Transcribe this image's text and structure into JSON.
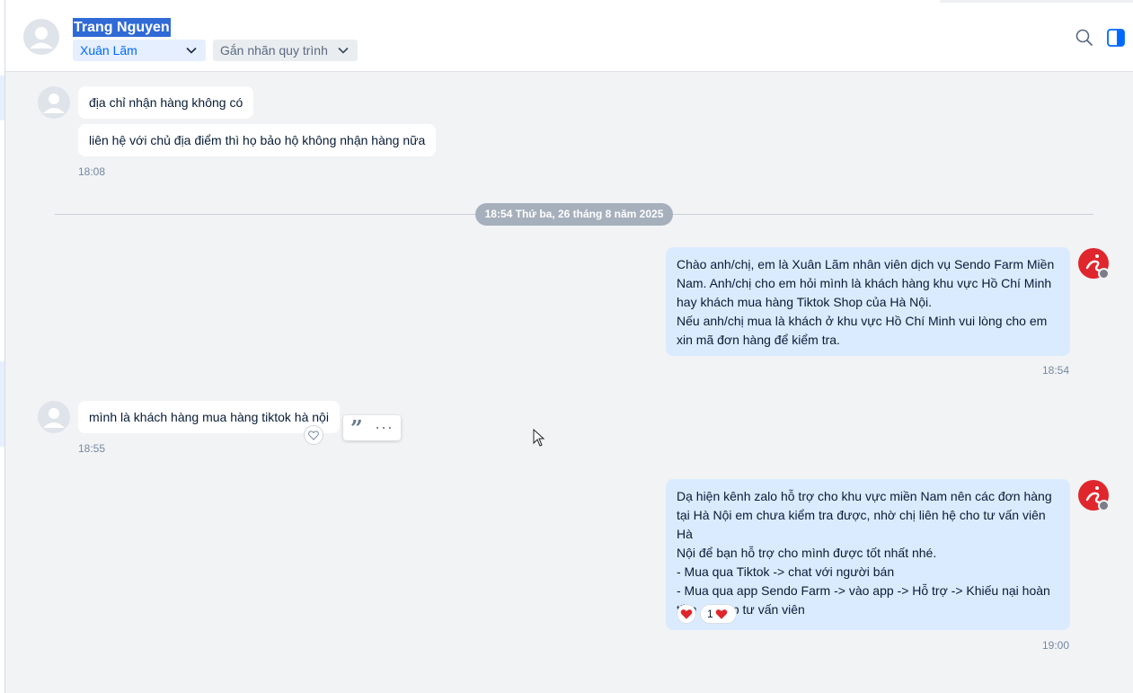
{
  "header": {
    "contact_name": "Trang Nguyen",
    "assignee": "Xuân Lãm",
    "tag_label": "Gắn nhãn quy trình",
    "search_icon": "search-icon",
    "panel_icon": "toggle-panel-icon",
    "accent_color": "#0068ff"
  },
  "chat": {
    "messages_top": [
      {
        "text": "địa chỉ nhận hàng không có"
      },
      {
        "text": "liên hệ với chủ địa điểm thì họ bảo hộ không nhận hàng nữa"
      }
    ],
    "time_1": "18:08",
    "date_divider": "18:54 Thứ ba, 26 tháng 8 năm 2025",
    "out_msg_1": [
      "Chào anh/chị, em là Xuân Lãm nhân viên dịch vụ Sendo Farm Miền",
      "Nam. Anh/chị cho em hỏi mình là khách hàng khu vực Hồ Chí Minh",
      "hay khách mua hàng Tiktok Shop của Hà Nội.",
      "Nếu anh/chị mua là khách ở khu vực Hồ Chí Minh vui lòng cho em",
      "xin mã đơn hàng để kiểm tra."
    ],
    "time_2": "18:54",
    "in_msg_2": "mình là khách hàng mua hàng tiktok hà nội",
    "time_3": "18:55",
    "out_msg_2": [
      "Dạ hiện kênh zalo hỗ trợ cho khu vực miền Nam nên các đơn hàng",
      "tại Hà Nội em chưa kiểm tra được, nhờ chị liên hệ cho tư vấn viên Hà",
      "Nội để bạn hỗ trợ cho mình được tốt nhất nhé.",
      "- Mua qua Tiktok -> chat với người bán",
      "- Mua qua app Sendo Farm -> vào app -> Hỗ trợ -> Khiếu nại hoàn",
      "tiền -> Gặp tư vấn viên"
    ],
    "reaction_count": "1",
    "time_4": "19:00"
  }
}
